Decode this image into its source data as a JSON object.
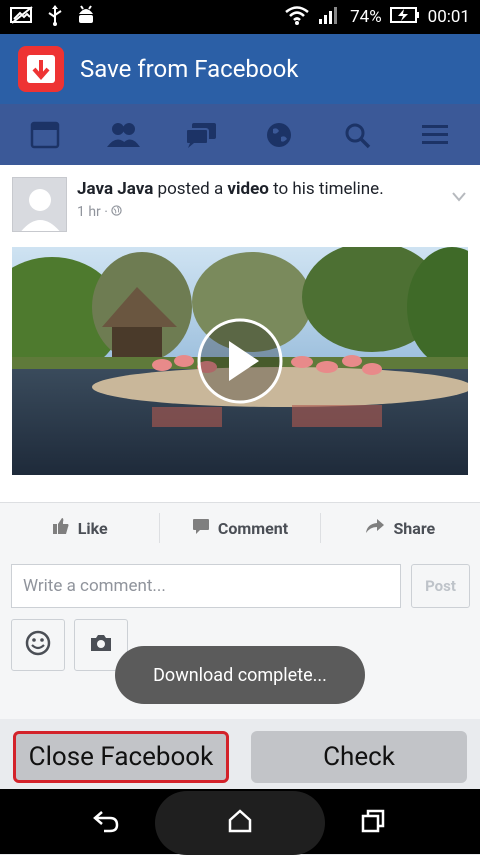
{
  "status": {
    "battery": "74%",
    "time": "00:01"
  },
  "app": {
    "title": "Save from Facebook"
  },
  "post": {
    "author": "Java Java",
    "verb": "posted a",
    "object": "video",
    "suffix": "to his timeline.",
    "time": "1 hr ·"
  },
  "actions": {
    "like": "Like",
    "comment": "Comment",
    "share": "Share"
  },
  "composer": {
    "placeholder": "Write a comment...",
    "post_label": "Post"
  },
  "toast": "Download complete...",
  "buttons": {
    "close": "Close Facebook",
    "check": "Check"
  },
  "colors": {
    "fb_blue": "#3b5998",
    "appbar": "#2b5fa6",
    "close_border": "#d3222a"
  }
}
